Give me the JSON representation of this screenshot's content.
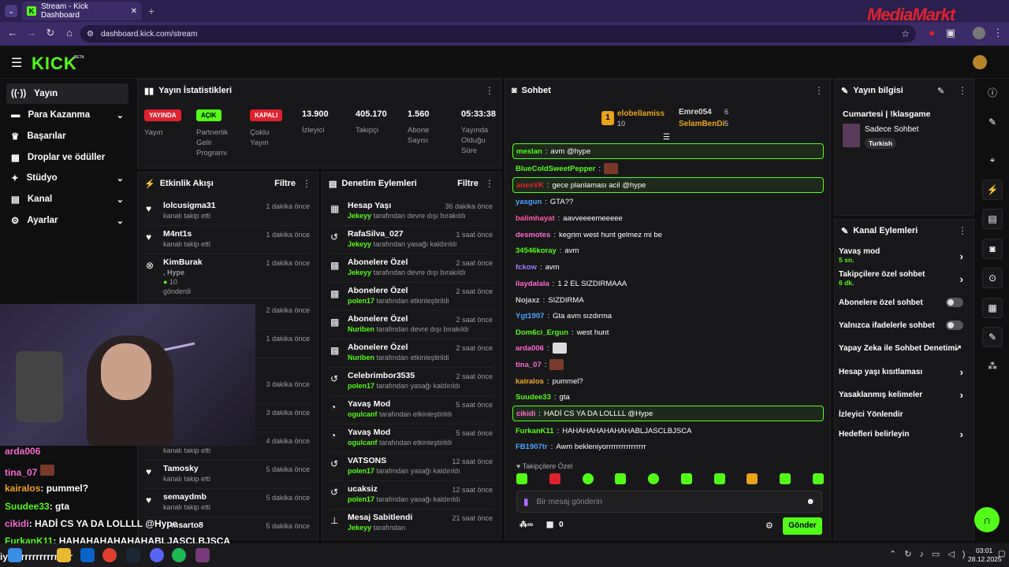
{
  "browser": {
    "tab_title": "Stream - Kick Dashboard",
    "url": "dashboard.kick.com/stream",
    "watermark": "MediaMarkt"
  },
  "app": {
    "logo": "KICK",
    "beta": "BETA"
  },
  "sidebar": {
    "items": [
      {
        "label": "Yayın",
        "icon": "broadcast-icon"
      },
      {
        "label": "Para Kazanma",
        "icon": "money-icon"
      },
      {
        "label": "Başarılar",
        "icon": "trophy-icon"
      },
      {
        "label": "Droplar ve ödüller",
        "icon": "gift-icon"
      },
      {
        "label": "Stüdyo",
        "icon": "studio-icon"
      },
      {
        "label": "Kanal",
        "icon": "channel-icon"
      },
      {
        "label": "Ayarlar",
        "icon": "gear-icon"
      }
    ]
  },
  "stats": {
    "title": "Yayın İstatistikleri",
    "items": [
      {
        "badge": "YAYINDA",
        "label": "Yayın",
        "color": "#e0222f"
      },
      {
        "badge": "AÇIK",
        "label": "Partnerlik Gelir Programı",
        "color": "#53fc18"
      },
      {
        "badge": "KAPALI",
        "label": "Çoklu Yayın",
        "color": "#e0222f"
      },
      {
        "value": "13.900",
        "label": "İzleyici"
      },
      {
        "value": "405.170",
        "label": "Takipçi"
      },
      {
        "value": "1.560",
        "label": "Abone Sayısı"
      },
      {
        "value": "05:33:38",
        "label": "Yayında Olduğu Süre"
      }
    ]
  },
  "activity": {
    "title": "Etkinlik Akışı",
    "filter": "Filtre",
    "items": [
      {
        "name": "lolcusigma31",
        "desc": "kanalı takip etti",
        "time": "1 dakika önce"
      },
      {
        "name": "M4nt1s",
        "desc": "kanalı takip etti",
        "time": "1 dakika önce"
      },
      {
        "name": "KimBurak",
        "desc": ", Hype",
        "extra": "10",
        "extra2": "gönderdi",
        "time": "1 dakika önce"
      },
      {
        "time": "2 dakika önce"
      },
      {
        "time": "1 dakika önce"
      },
      {
        "time": "3 dakika önce"
      },
      {
        "time": "3 dakika önce"
      },
      {
        "desc": "kanalı takip etti",
        "time": "4 dakika önce"
      },
      {
        "name": "Tamosky",
        "desc": "kanalı takip etti",
        "time": "5 dakika önce"
      },
      {
        "name": "semaydmb",
        "desc": "kanalı takip etti",
        "time": "5 dakika önce"
      },
      {
        "name": "msarto8",
        "time": "5 dakika önce"
      }
    ]
  },
  "moderation": {
    "title": "Denetim Eylemleri",
    "filter": "Filtre",
    "items": [
      {
        "name": "Hesap Yaşı",
        "user": "Jekeyy",
        "desc": "tarafından devre dışı bırakıldı",
        "time": "36 dakika önce"
      },
      {
        "name": "RafaSilva_027",
        "user": "Jekeyy",
        "desc": "tarafından yasağı kaldırıldı",
        "time": "1 saat önce"
      },
      {
        "name": "Abonelere Özel",
        "user": "Jekeyy",
        "desc": "tarafından devre dışı bırakıldı",
        "time": "2 saat önce"
      },
      {
        "name": "Abonelere Özel",
        "user": "polen17",
        "desc": "tarafından etkinleştirildi",
        "time": "2 saat önce"
      },
      {
        "name": "Abonelere Özel",
        "user": "Nuriben",
        "desc": "tarafından devre dışı bırakıldı",
        "time": "2 saat önce"
      },
      {
        "name": "Abonelere Özel",
        "user": "Nuriben",
        "desc": "tarafından etkinleştirildi",
        "time": "2 saat önce"
      },
      {
        "name": "Celebrimbor3535",
        "user": "polen17",
        "desc": "tarafından yasağı kaldırıldı",
        "time": "2 saat önce"
      },
      {
        "name": "Yavaş Mod",
        "user": "ogulcanf",
        "desc": "tarafından etkinleştirildi",
        "time": "5 saat önce"
      },
      {
        "name": "Yavaş Mod",
        "user": "ogulcanf",
        "desc": "tarafından etkinleştirildi",
        "time": "5 saat önce"
      },
      {
        "name": "VATSONS",
        "user": "polen17",
        "desc": "tarafından yasağı kaldırıldı",
        "time": "12 saat önce"
      },
      {
        "name": "ucaksiz",
        "user": "polen17",
        "desc": "tarafından yasağı kaldırıldı",
        "time": "12 saat önce"
      },
      {
        "name": "Mesaj Sabitlendi",
        "user": "Jekeyy",
        "desc": "tarafından",
        "time": "21 saat önce"
      }
    ]
  },
  "chat": {
    "title": "Sohbet",
    "top": {
      "rank": "1",
      "user1": "elobellamiss",
      "count1": "10",
      "user2": "Emre054",
      "count2": "6",
      "user3": "SelamBenDi",
      "count3": "5"
    },
    "messages": [
      {
        "user": "meslan",
        "text": "avm @hype",
        "color": "#53fc18",
        "hl": true
      },
      {
        "user": "BlueColdSweetPepper",
        "text": "",
        "color": "#53fc18",
        "emote": true
      },
      {
        "user": "anesVK",
        "text": "gece planlaması acil @hype",
        "color": "#e0222f",
        "hl": true
      },
      {
        "user": "yasgun",
        "text": "GTA??",
        "color": "#4aa3ff"
      },
      {
        "user": "balimhayat",
        "text": "aavveeeemeeeee",
        "color": "#ff5ca8"
      },
      {
        "user": "desmotes",
        "text": "kegrim west hunt gelmez mi be",
        "color": "#ff6ad5"
      },
      {
        "user": "34546koray",
        "text": "avm",
        "color": "#53fc18"
      },
      {
        "user": "fckow",
        "text": "avm",
        "color": "#9b7bff"
      },
      {
        "user": "ilaydalala",
        "text": "1 2 EL SIZDIRMAAA",
        "color": "#ff6ad5"
      },
      {
        "user": "Nojaxz",
        "text": "SIZDIRMA",
        "color": "#cccccc"
      },
      {
        "user": "Ygt1907",
        "text": "Gta avm sızdırma",
        "color": "#4aa3ff"
      },
      {
        "user": "Dom6ci_Ergun",
        "text": "west hunt",
        "color": "#53fc18"
      },
      {
        "user": "arda006",
        "text": "",
        "color": "#ff6ad5",
        "emote": true
      },
      {
        "user": "tina_07",
        "text": "",
        "color": "#ff6ad5",
        "emote": true
      },
      {
        "user": "kairalos",
        "text": "pummel?",
        "color": "#f5a623"
      },
      {
        "user": "Suudee33",
        "text": "gta",
        "color": "#53fc18"
      },
      {
        "user": "cikidi",
        "text": "HADİ CS YA DA LOLLLL @Hype",
        "color": "#ff6ad5",
        "hl": true
      },
      {
        "user": "FurkanK11",
        "text": "HAHAHAHAHAHAHABLJASCLBJSCA",
        "color": "#53fc18"
      },
      {
        "user": "FB1907tr",
        "text": "Awm bekleniyorrrrrrrrrrrrrrrr",
        "color": "#4aa3ff"
      }
    ],
    "followers_only": "Takipçilere Özel",
    "placeholder": "Bir mesaj gönderin",
    "send": "Gönder",
    "points": "0"
  },
  "info": {
    "title": "Yayın bilgisi",
    "stream_title": "Cumartesi | !klasgame",
    "category": "Sadece Sohbet",
    "tag": "Turkish"
  },
  "channel_actions": {
    "title": "Kanal Eylemleri",
    "items": [
      {
        "label": "Yavaş mod",
        "sub": "5 sn.",
        "type": "chevron"
      },
      {
        "label": "Takipçilere özel sohbet",
        "sub": "6 dk.",
        "type": "chevron"
      },
      {
        "label": "Abonelere özel sohbet",
        "type": "toggle"
      },
      {
        "label": "Yalnızca ifadelerle sohbet",
        "type": "toggle"
      },
      {
        "label": "Yapay Zeka ile Sohbet Denetimi",
        "type": "external"
      },
      {
        "label": "Hesap yaşı kısıtlaması",
        "type": "chevron"
      },
      {
        "label": "Yasaklanmış kelimeler",
        "type": "chevron"
      },
      {
        "label": "İzleyici Yönlendir",
        "type": "none"
      },
      {
        "label": "Hedefleri belirleyin",
        "type": "chevron"
      }
    ]
  },
  "overlay_chat": [
    {
      "user": "arda006",
      "text": "",
      "color": "#ff6ad5"
    },
    {
      "user": "tina_07",
      "text": "",
      "color": "#ff6ad5"
    },
    {
      "user": "kairalos",
      "text": ": pummel?",
      "color": "#f5a623"
    },
    {
      "user": "Suudee33",
      "text": ": gta",
      "color": "#53fc18"
    },
    {
      "user": "cikidi",
      "text": ": HADİ CS YA DA LOLLLL @Hype",
      "color": "#ff6ad5"
    },
    {
      "user": "FurkanK11",
      "text": ": HAHAHAHAHAHAHABLJASCLBJSCA",
      "color": "#53fc18"
    },
    {
      "user": "",
      "text": "iyorrrrrrrrrrrrrrrr",
      "color": "#ffffff"
    }
  ],
  "taskbar": {
    "time": "03:01",
    "date": "28.12.2025"
  }
}
